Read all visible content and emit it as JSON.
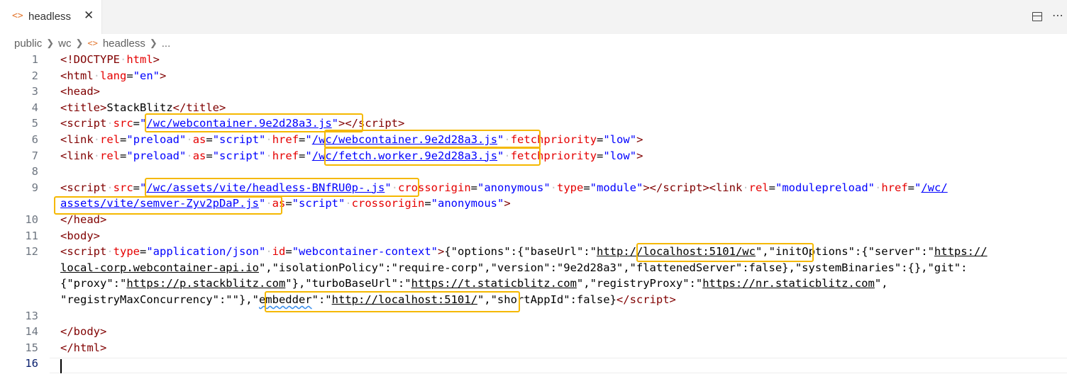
{
  "tab": {
    "label": "headless",
    "close": "✕"
  },
  "breadcrumb": {
    "items": [
      "public",
      "wc",
      "headless",
      "..."
    ]
  },
  "lines": [
    {
      "n": "1",
      "y": 0,
      "html": "<span class='t'>&lt;!DOCTYPE</span><span class='d'>·</span><span class='a'>html</span><span class='t'>&gt;</span>"
    },
    {
      "n": "2",
      "y": 1,
      "html": "<span class='t'>&lt;html</span><span class='d'>·</span><span class='a'>lang</span><span class='p'>=</span><span class='s'>\"en\"</span><span class='t'>&gt;</span>"
    },
    {
      "n": "3",
      "y": 2,
      "html": "<span class='t'>&lt;head&gt;</span>"
    },
    {
      "n": "4",
      "y": 3,
      "html": "<span class='t'>&lt;title&gt;</span><span class='p'>StackBlitz</span><span class='t'>&lt;/title&gt;</span>"
    },
    {
      "n": "5",
      "y": 4,
      "html": "<span class='t'>&lt;script</span><span class='d'>·</span><span class='a'>src</span><span class='p'>=</span><span class='s'>\"</span><span class='u'>/wc/webcontainer.9e2d28a3.js</span><span class='s'>\"</span><span class='t'>&gt;&lt;/script&gt;</span>"
    },
    {
      "n": "6",
      "y": 5,
      "html": "<span class='t'>&lt;link</span><span class='d'>·</span><span class='a'>rel</span><span class='p'>=</span><span class='s'>\"preload\"</span><span class='d'>·</span><span class='a'>as</span><span class='p'>=</span><span class='s'>\"script\"</span><span class='d'>·</span><span class='a'>href</span><span class='p'>=</span><span class='s'>\"</span><span class='u'>/wc/webcontainer.9e2d28a3.js</span><span class='s'>\"</span><span class='d'>·</span><span class='a'>fetchpriority</span><span class='p'>=</span><span class='s'>\"low\"</span><span class='t'>&gt;</span>"
    },
    {
      "n": "7",
      "y": 6,
      "html": "<span class='t'>&lt;link</span><span class='d'>·</span><span class='a'>rel</span><span class='p'>=</span><span class='s'>\"preload\"</span><span class='d'>·</span><span class='a'>as</span><span class='p'>=</span><span class='s'>\"script\"</span><span class='d'>·</span><span class='a'>href</span><span class='p'>=</span><span class='s'>\"</span><span class='u'>/wc/fetch.worker.9e2d28a3.js</span><span class='s'>\"</span><span class='d'>·</span><span class='a'>fetchpriority</span><span class='p'>=</span><span class='s'>\"low\"</span><span class='t'>&gt;</span>"
    },
    {
      "n": "8",
      "y": 7,
      "html": ""
    },
    {
      "n": "9",
      "y": 8,
      "html": "<span class='t'>&lt;script</span><span class='d'>·</span><span class='a'>src</span><span class='p'>=</span><span class='s'>\"</span><span class='u'>/wc/assets/vite/headless-BNfRU0p-.js</span><span class='s'>\"</span><span class='d'>·</span><span class='a'>crossorigin</span><span class='p'>=</span><span class='s'>\"anonymous\"</span><span class='d'>·</span><span class='a'>type</span><span class='p'>=</span><span class='s'>\"module\"</span><span class='t'>&gt;&lt;/script&gt;&lt;link</span><span class='d'>·</span><span class='a'>rel</span><span class='p'>=</span><span class='s'>\"modulepreload\"</span><span class='d'>·</span><span class='a'>href</span><span class='p'>=</span><span class='s'>\"</span><span class='u'>/wc/</span>"
    },
    {
      "n": "",
      "y": 9,
      "html": "<span class='u'>assets/vite/semver-Zyv2pDaP.js</span><span class='s'>\"</span><span class='d'>·</span><span class='a'>as</span><span class='p'>=</span><span class='s'>\"script\"</span><span class='d'>·</span><span class='a'>crossorigin</span><span class='p'>=</span><span class='s'>\"anonymous\"</span><span class='t'>&gt;</span>"
    },
    {
      "n": "10",
      "y": 10,
      "html": "<span class='t'>&lt;/head&gt;</span>"
    },
    {
      "n": "11",
      "y": 11,
      "html": "<span class='t'>&lt;body&gt;</span>"
    },
    {
      "n": "12",
      "y": 12,
      "html": "<span class='t'>&lt;script</span><span class='d'>·</span><span class='a'>type</span><span class='p'>=</span><span class='s'>\"application/json\"</span><span class='d'>·</span><span class='a'>id</span><span class='p'>=</span><span class='s'>\"webcontainer-context\"</span><span class='t'>&gt;</span><span class='p'>{\"options\":{\"baseUrl\":\"</span><span class='p' style='text-decoration:underline'>http://localhost:5101/wc</span><span class='p'>\",\"initOptions\":{\"server\":\"</span><span class='p' style='text-decoration:underline'>https://</span>"
    },
    {
      "n": "",
      "y": 13,
      "html": "<span class='p' style='text-decoration:underline'>local-corp.webcontainer-api.io</span><span class='p'>\",\"isolationPolicy\":\"require-corp\",\"version\":\"9e2d28a3\",\"flattenedServer\":false},\"systemBinaries\":{},\"git\":</span>"
    },
    {
      "n": "",
      "y": 14,
      "html": "<span class='p'>{\"proxy\":\"</span><span class='p' style='text-decoration:underline'>https://p.stackblitz.com</span><span class='p'>\"},\"turboBaseUrl\":\"</span><span class='p' style='text-decoration:underline'>https://t.staticblitz.com</span><span class='p'>\",\"registryProxy\":\"</span><span class='p' style='text-decoration:underline'>https://nr.staticblitz.com</span><span class='p'>\",</span>"
    },
    {
      "n": "",
      "y": 15,
      "html": "<span class='p'>\"registryMaxConcurrency\":\"\"},\"</span><span class='p sq'>embedder</span><span class='p'>\":\"</span><span class='p' style='text-decoration:underline'>http://localhost:5101/</span><span class='p'>\",\"shortAppId\":false}</span><span class='t'>&lt;/script&gt;</span>"
    },
    {
      "n": "13",
      "y": 16,
      "html": ""
    },
    {
      "n": "14",
      "y": 17,
      "html": "<span class='t'>&lt;/body&gt;</span>"
    },
    {
      "n": "15",
      "y": 18,
      "html": "<span class='t'>&lt;/html&gt;</span>"
    },
    {
      "n": "16",
      "y": 19,
      "html": "",
      "active": true
    }
  ]
}
